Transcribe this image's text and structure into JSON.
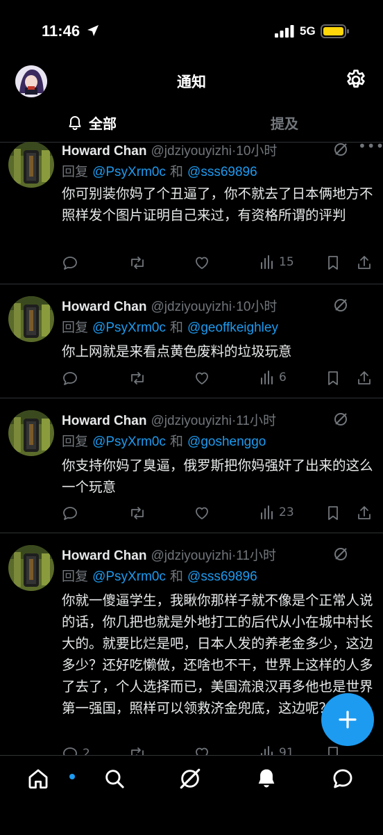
{
  "status_bar": {
    "time": "11:46",
    "network": "5G"
  },
  "header": {
    "title": "通知"
  },
  "tabs": {
    "all": "全部",
    "mentions": "提及"
  },
  "tweets": [
    {
      "name": "Howard Chan",
      "handle": "@jdziyouyizhi",
      "time": "·10小时",
      "reply_prefix": "回复",
      "mention1": "@PsyXrm0c",
      "joiner": "和",
      "mention2": "@sss69896",
      "text": "你可别装你妈了个丑逼了，你不就去了日本俩地方不照样发个图片证明自己来过，有资格所谓的评判",
      "views": "15"
    },
    {
      "name": "Howard Chan",
      "handle": "@jdziyouyizhi",
      "time": "·10小时",
      "reply_prefix": "回复",
      "mention1": "@PsyXrm0c",
      "joiner": "和",
      "mention2": "@geoffkeighley",
      "text": "你上网就是来看点黄色废料的垃圾玩意",
      "views": "6"
    },
    {
      "name": "Howard Chan",
      "handle": "@jdziyouyizhi",
      "time": "·11小时",
      "reply_prefix": "回复",
      "mention1": "@PsyXrm0c",
      "joiner": "和",
      "mention2": "@goshenggo",
      "text": "你支持你妈了臭逼，俄罗斯把你妈强奸了出来的这么一个玩意",
      "views": "23"
    },
    {
      "name": "Howard Chan",
      "handle": "@jdziyouyizhi",
      "time": "·11小时",
      "reply_prefix": "回复",
      "mention1": "@PsyXrm0c",
      "joiner": "和",
      "mention2": "@sss69896",
      "text": "你就一傻逼学生，我瞅你那样子就不像是个正常人说的话，你几把也就是外地打工的后代从小在城中村长大的。就要比烂是吧，日本人发的养老金多少，这边多少？还好吃懒做，还啥也不干，世界上这样的人多了去了，个人选择而已，美国流浪汉再多他也是世界第一强国，照样可以领救济金兜底，这边呢？",
      "replies": "2",
      "views": "91"
    }
  ],
  "colors": {
    "accent": "#1d9bf0",
    "muted": "#71767b",
    "text": "#e7e9ea",
    "background": "#000000"
  }
}
